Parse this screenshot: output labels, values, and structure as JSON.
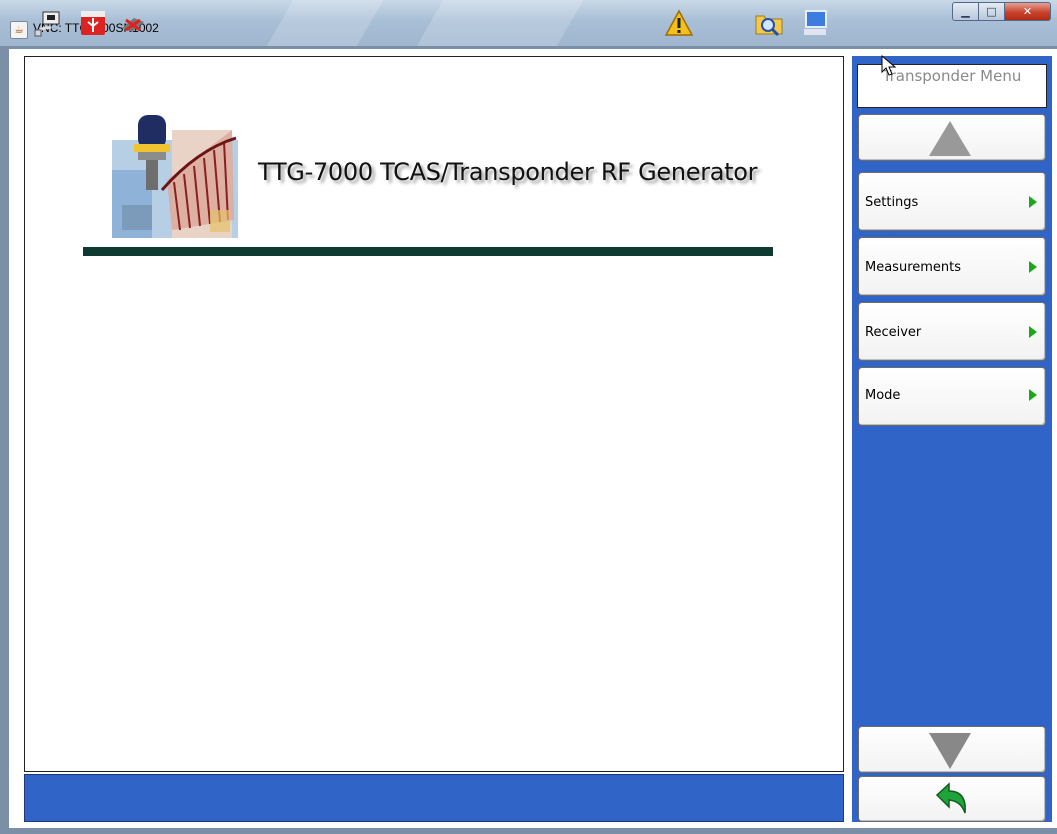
{
  "window": {
    "title": "VNC: TTG7000SN1002",
    "controls": [
      "minimize",
      "maximize",
      "close"
    ]
  },
  "main": {
    "product_title": "TTG-7000 TCAS/Transponder RF Generator",
    "logo_icon": "tower-antenna-logo-icon"
  },
  "menu": {
    "title": "Transponder Menu",
    "items": [
      {
        "label": "Settings"
      },
      {
        "label": "Measurements"
      },
      {
        "label": "Receiver"
      },
      {
        "label": "Mode"
      }
    ],
    "scroll_up_icon": "arrow-up-icon",
    "scroll_down_icon": "arrow-down-icon",
    "back_icon": "back-arrow-icon"
  },
  "statusbar": {
    "icons": [
      "network-icon",
      "usb-icon",
      "gps-icon",
      "warning-icon",
      "folder-search-icon",
      "computer-icon"
    ]
  },
  "colors": {
    "panel_blue": "#3065c7",
    "rule": "#0e3a32",
    "menu_arrow": "#1ba81b"
  }
}
